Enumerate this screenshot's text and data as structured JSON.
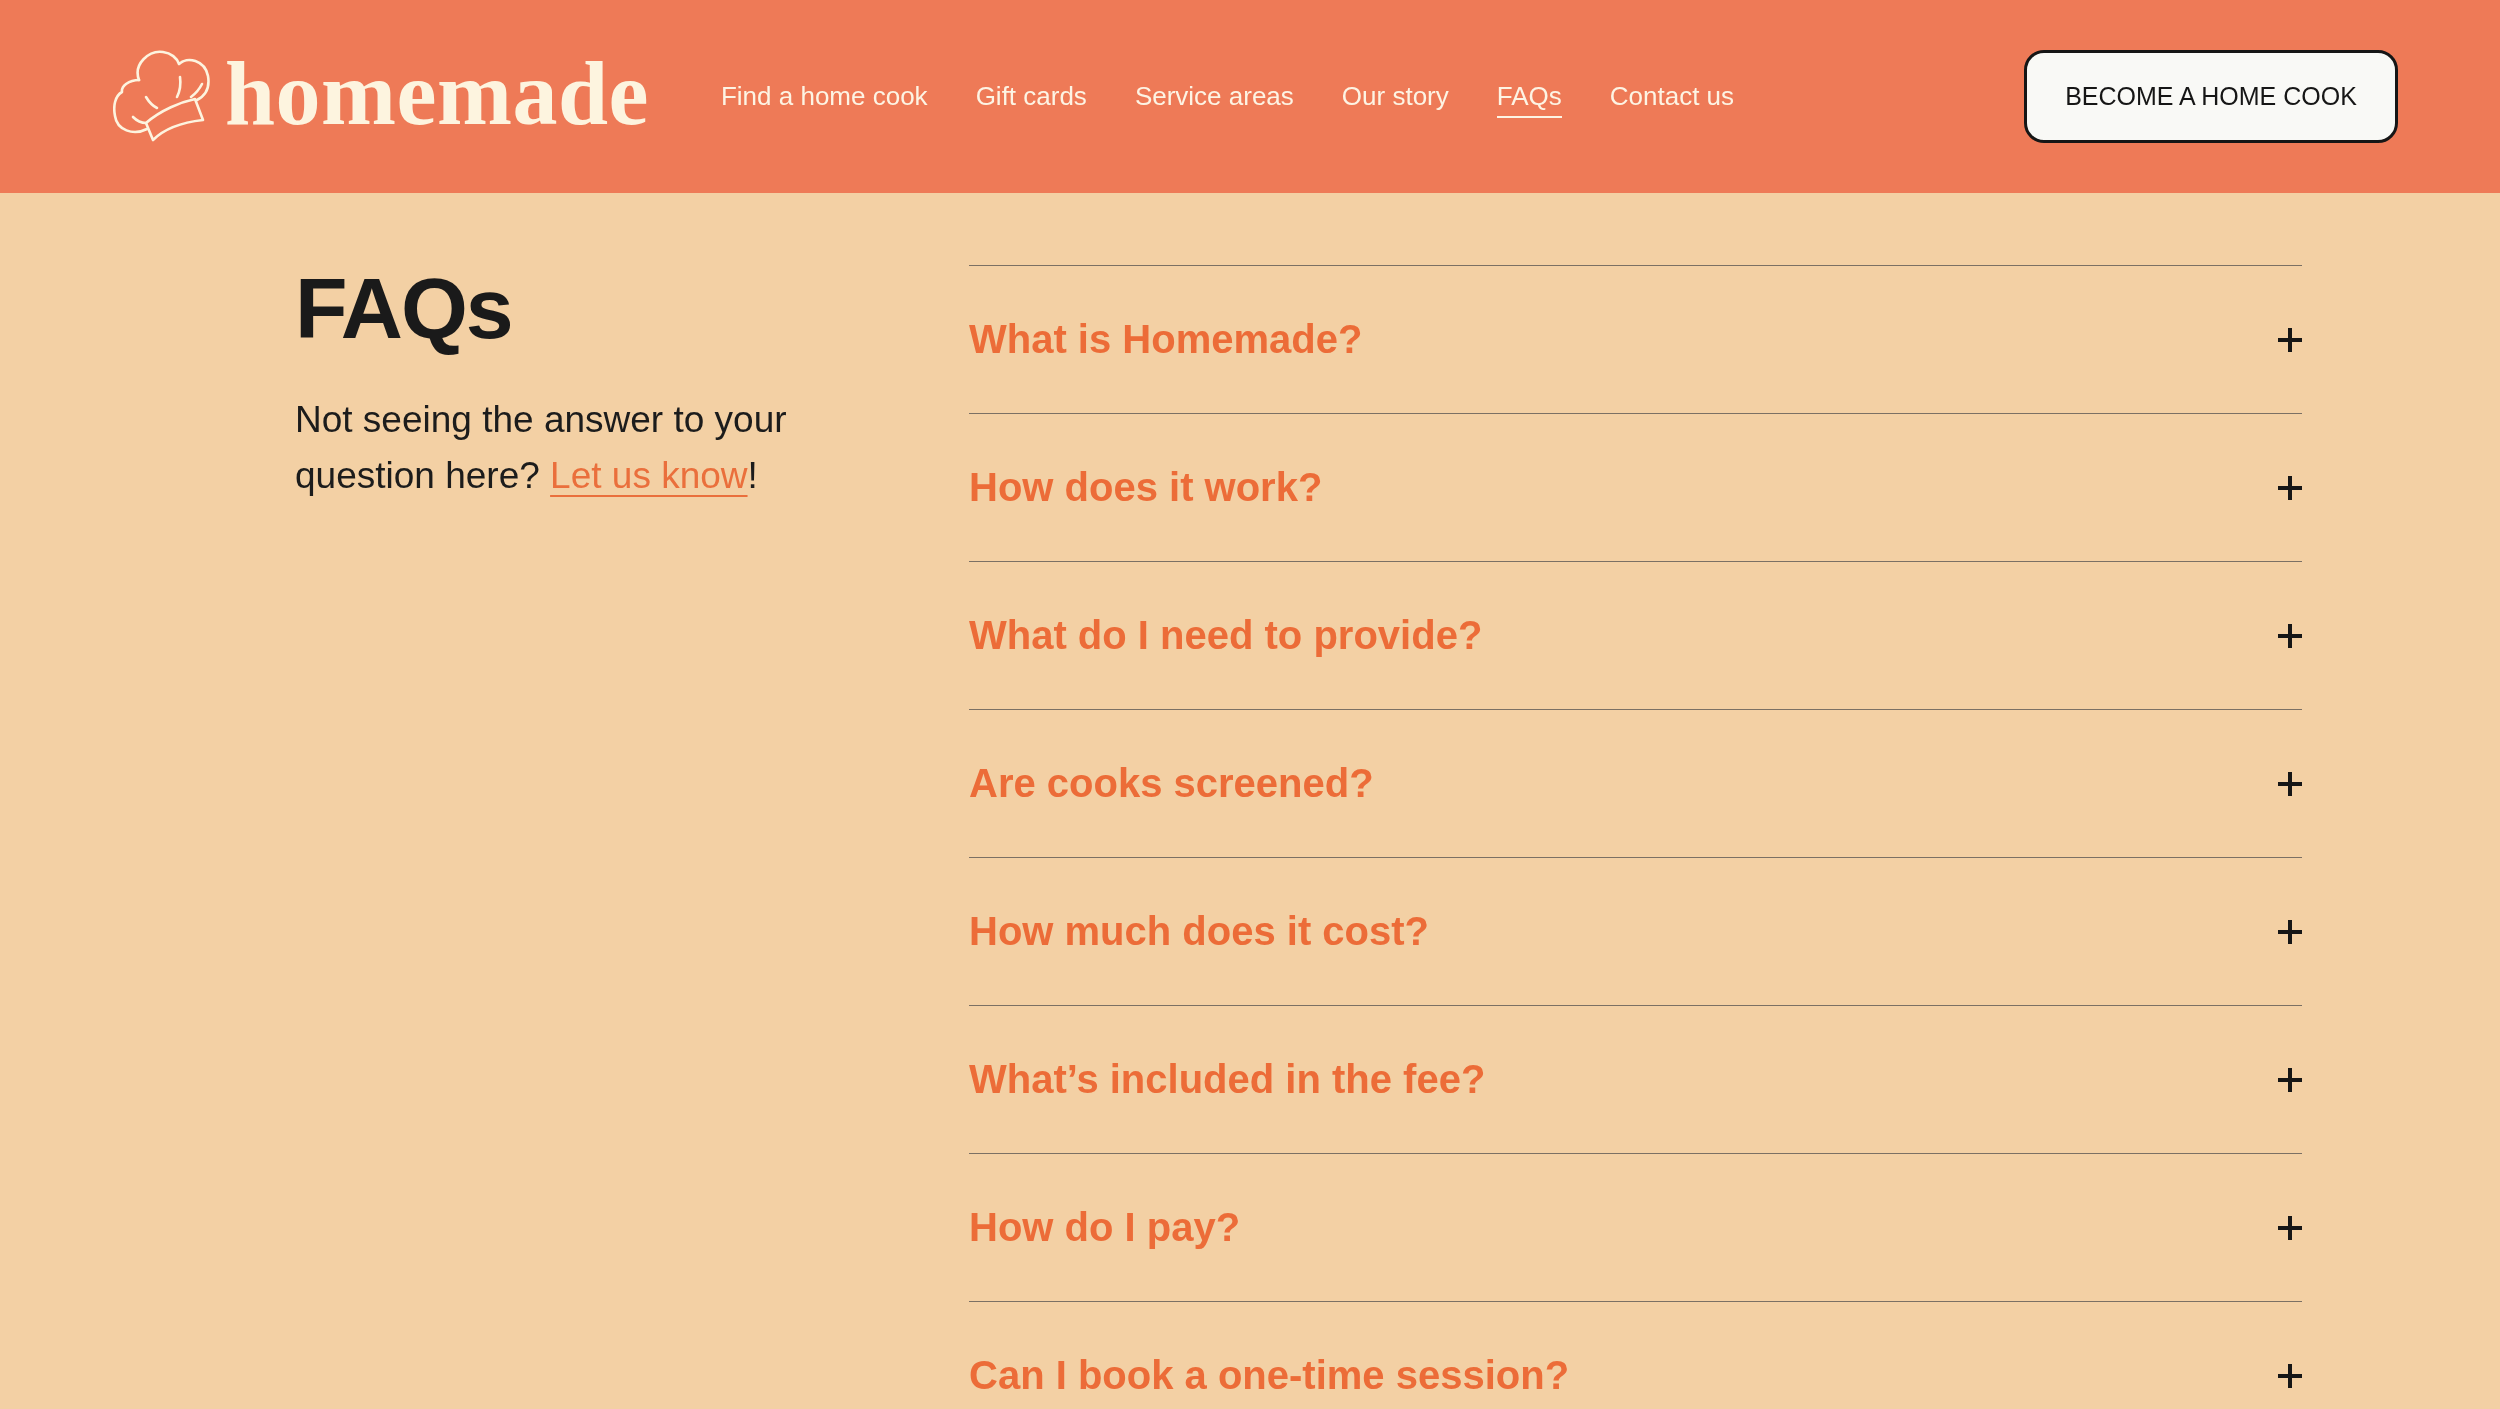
{
  "header": {
    "logo": {
      "wordmark": "homemade"
    },
    "nav": [
      {
        "label": "Find a home cook",
        "selected": false
      },
      {
        "label": "Gift cards",
        "selected": false
      },
      {
        "label": "Service areas",
        "selected": false
      },
      {
        "label": "Our story",
        "selected": false
      },
      {
        "label": "FAQs",
        "selected": true
      },
      {
        "label": "Contact us",
        "selected": false
      }
    ],
    "cta": "BECOME A HOME COOK"
  },
  "intro": {
    "title": "FAQs",
    "text_before": "Not seeing the answer to your question here?",
    "link": "Let us know",
    "text_after": "!"
  },
  "faqs": [
    {
      "question": "What is Homemade?",
      "expanded": false
    },
    {
      "question": "How does it work?",
      "expanded": false
    },
    {
      "question": "What do I need to provide?",
      "expanded": false
    },
    {
      "question": "Are cooks screened?",
      "expanded": false
    },
    {
      "question": "How much does it cost?",
      "expanded": false
    },
    {
      "question": "What’s included in the fee?",
      "expanded": false
    },
    {
      "question": "How do I pay?",
      "expanded": false
    },
    {
      "question": "Can I book a one-time session?",
      "expanded": false
    }
  ]
}
